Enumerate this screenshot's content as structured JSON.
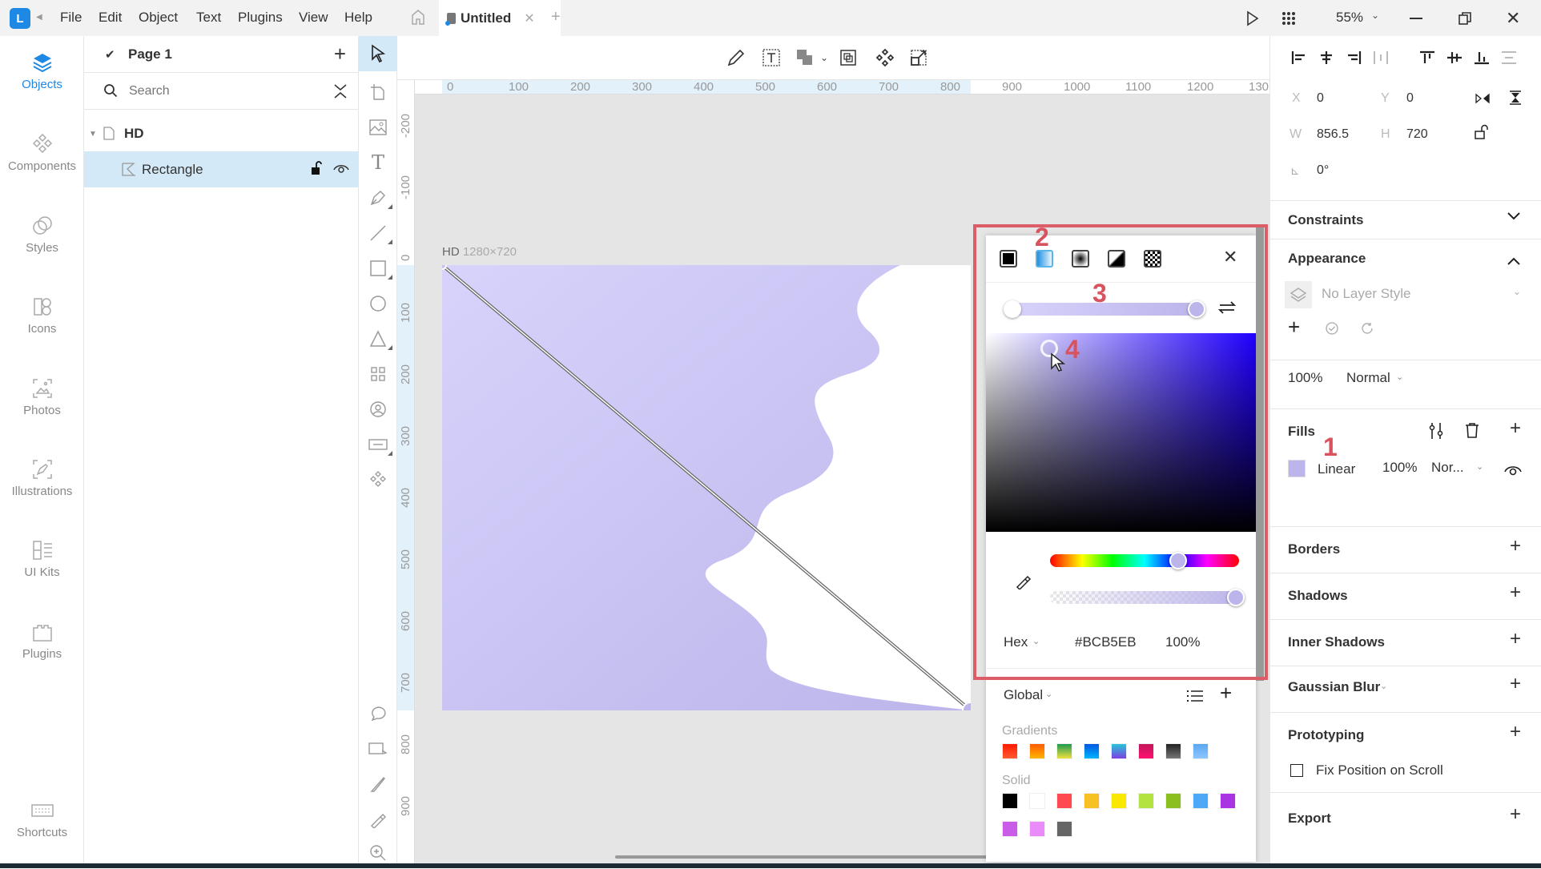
{
  "titlebar": {
    "logo": "L",
    "menus": [
      "File",
      "Edit",
      "Object",
      "Text",
      "Plugins",
      "View",
      "Help"
    ],
    "tab_title": "Untitled",
    "zoom": "55%"
  },
  "nav": [
    {
      "label": "Objects",
      "icon": "layers-icon",
      "active": true
    },
    {
      "label": "Components",
      "icon": "components-icon"
    },
    {
      "label": "Styles",
      "icon": "styles-icon"
    },
    {
      "label": "Icons",
      "icon": "icons-icon"
    },
    {
      "label": "Photos",
      "icon": "photos-icon"
    },
    {
      "label": "Illustrations",
      "icon": "illustrations-icon"
    },
    {
      "label": "UI Kits",
      "icon": "ui-kits-icon"
    },
    {
      "label": "Plugins",
      "icon": "plugins-icon"
    },
    {
      "label": "Shortcuts",
      "icon": "keyboard-icon"
    }
  ],
  "layers": {
    "page": "Page 1",
    "search_placeholder": "Search",
    "artboard": "HD",
    "layer": "Rectangle"
  },
  "canvas": {
    "artboard_name": "HD",
    "artboard_size": "1280×720",
    "fill_start": "#D7D3FB",
    "fill_end": "#BCB5EB",
    "ruler_h": [
      "0",
      "100",
      "200",
      "300",
      "400",
      "500",
      "600",
      "700",
      "800",
      "900",
      "1000",
      "1100",
      "1200",
      "130"
    ],
    "ruler_v": [
      "-200",
      "-100",
      "0",
      "100",
      "200",
      "300",
      "400",
      "500",
      "600",
      "700",
      "800",
      "900"
    ]
  },
  "props": {
    "x_label": "X",
    "x": "0",
    "y_label": "Y",
    "y": "0",
    "w_label": "W",
    "w": "856.5",
    "h_label": "H",
    "h": "720",
    "rotation": "0°",
    "constraints": "Constraints",
    "appearance": "Appearance",
    "layer_style": "No Layer Style",
    "opacity": "100%",
    "blend": "Normal",
    "fills": "Fills",
    "fill_type": "Linear",
    "fill_opacity": "100%",
    "fill_blend": "Nor...",
    "fill_color": "#BCB5EB",
    "borders": "Borders",
    "shadows": "Shadows",
    "inner_shadows": "Inner Shadows",
    "gaussian_blur": "Gaussian Blur",
    "prototyping": "Prototyping",
    "fix_position": "Fix Position on Scroll",
    "export": "Export"
  },
  "picker": {
    "format": "Hex",
    "hex": "#BCB5EB",
    "alpha": "100%",
    "hue_position": 0.68,
    "alpha_position": 1.0,
    "library": "Global",
    "gradients_label": "Gradients",
    "solid_label": "Solid",
    "gradients": [
      [
        "#ff1a00",
        "#ff5a36"
      ],
      [
        "#ff5a00",
        "#ffb400"
      ],
      [
        "#1e9b4f",
        "#f0e040"
      ],
      [
        "#0057e0",
        "#00b4ff"
      ],
      [
        "#26c6da",
        "#7e3fe0"
      ],
      [
        "#c2185b",
        "#ff1070"
      ],
      [
        "#222222",
        "#777777"
      ],
      [
        "#5aa7f0",
        "#8cc6ff"
      ]
    ],
    "solids": [
      "#000000",
      "#ffffff",
      "#ff4a4f",
      "#f7c124",
      "#fbe800",
      "#b2e33e",
      "#8bbf1f",
      "#4da8f7",
      "#a834e4",
      "#c95de8",
      "#e98cfa",
      "#666666"
    ]
  },
  "annotations": [
    "1",
    "2",
    "3",
    "4"
  ]
}
